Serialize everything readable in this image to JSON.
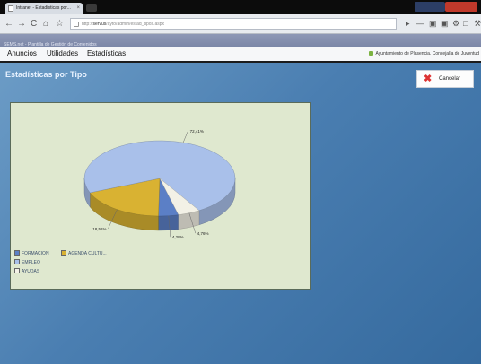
{
  "browser": {
    "tab_title": "Intranet - Estadísticas por...",
    "tab_close": "×",
    "url_prefix": "http://",
    "url_host": "servus",
    "url_path": "/ayto/admin/estad_tipos.aspx",
    "back_icon": "back-arrow-icon",
    "forward_icon": "forward-arrow-icon",
    "reload_icon": "reload-icon",
    "home_icon": "home-icon",
    "star_icon": "star-icon"
  },
  "app": {
    "header_text": "SEMS.net - Plantilla de Gestión de Contenidos",
    "menu": [
      "Anuncios",
      "Utilidades",
      "Estadísticas"
    ],
    "user_text": "Ayuntamiento de Plasencia. Concejalía de Juventud"
  },
  "page": {
    "title": "Estadísticas por Tipo",
    "cancel_label": "Cancelar"
  },
  "chart_data": {
    "type": "pie",
    "slices": [
      {
        "name": "FORMACION",
        "label": "4,28%",
        "value": 4.28,
        "color": "#5b7fc6"
      },
      {
        "name": "AGENDA CULTU...",
        "label": "18,51%",
        "value": 18.51,
        "color": "#d9b232"
      },
      {
        "name": "EMPLEO",
        "label": "72,41%",
        "value": 72.41,
        "color": "#a9c0ea"
      },
      {
        "name": "AYUDAS",
        "label": "4,76%",
        "value": 4.76,
        "color": "#f3f1e6"
      }
    ]
  }
}
